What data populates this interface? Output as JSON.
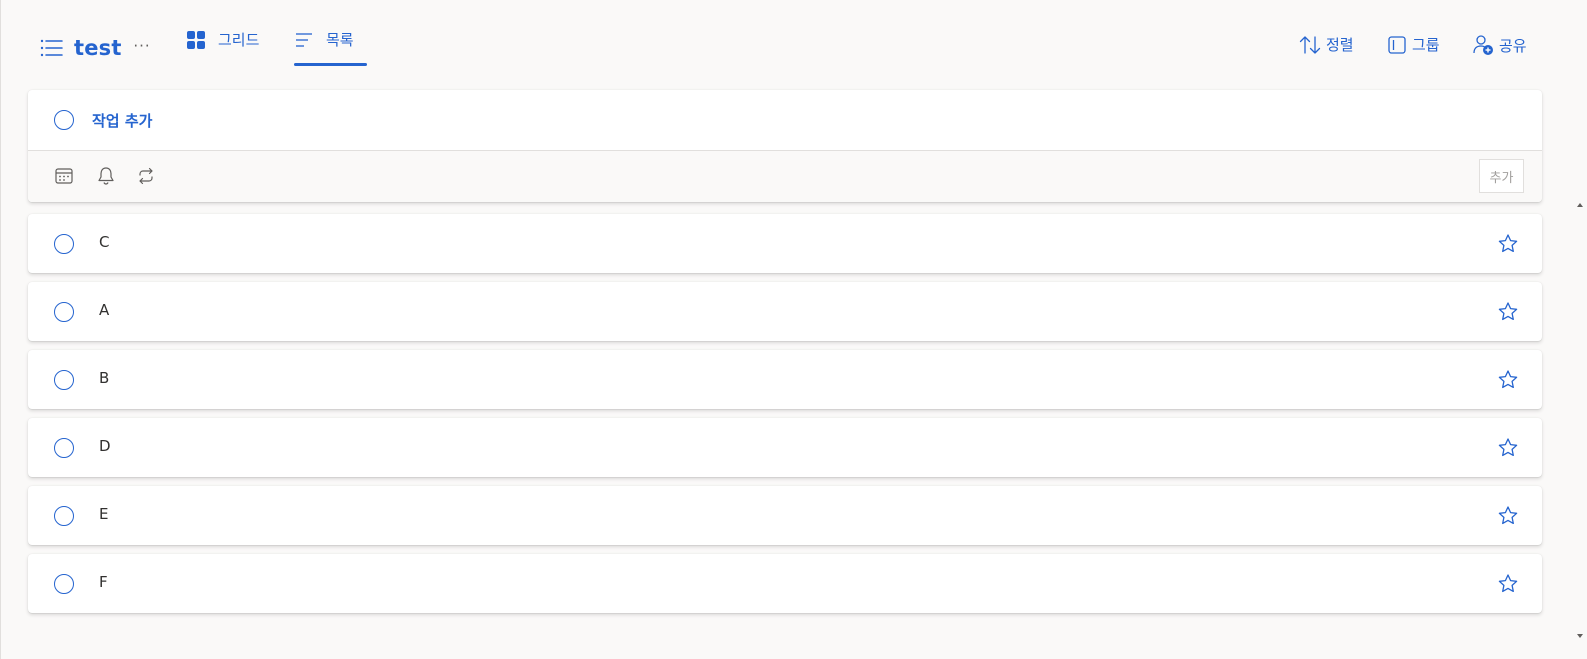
{
  "header": {
    "list_title": "test",
    "more_label": "···",
    "tabs": [
      {
        "label": "그리드",
        "icon": "grid-icon",
        "selected": false
      },
      {
        "label": "목록",
        "icon": "list-view-icon",
        "selected": true
      }
    ],
    "actions": [
      {
        "label": "정렬",
        "icon": "sort-icon"
      },
      {
        "label": "그룹",
        "icon": "group-icon"
      },
      {
        "label": "공유",
        "icon": "share-person-icon"
      }
    ]
  },
  "add_task": {
    "label": "작업 추가",
    "add_button_label": "추가",
    "toolbar_icons": [
      "calendar-icon",
      "bell-icon",
      "repeat-icon"
    ]
  },
  "tasks": [
    {
      "title": "C",
      "important": false
    },
    {
      "title": "A",
      "important": false
    },
    {
      "title": "B",
      "important": false
    },
    {
      "title": "D",
      "important": false
    },
    {
      "title": "E",
      "important": false
    },
    {
      "title": "F",
      "important": false
    }
  ],
  "colors": {
    "accent": "#2564cf",
    "background": "#faf9f8",
    "card": "#ffffff",
    "text": "#323130"
  }
}
